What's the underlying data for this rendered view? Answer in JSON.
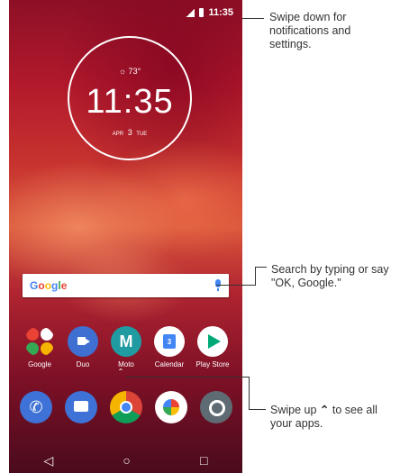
{
  "status_bar": {
    "time": "11:35"
  },
  "clock_widget": {
    "weather": "☼ 73°",
    "time": "11:35",
    "month": "APR",
    "day": "3",
    "weekday": "TUE"
  },
  "search_bar": {
    "logo": [
      "G",
      "o",
      "o",
      "g",
      "l",
      "e"
    ]
  },
  "apps": [
    {
      "label": "Google",
      "icon": "google-folder-icon"
    },
    {
      "label": "Duo",
      "icon": "duo-icon"
    },
    {
      "label": "Moto",
      "icon": "moto-icon"
    },
    {
      "label": "Calendar",
      "icon": "calendar-icon"
    },
    {
      "label": "Play Store",
      "icon": "play-store-icon"
    }
  ],
  "calendar_day": "3",
  "moto_glyph": "M",
  "dock": [
    {
      "icon": "phone-icon"
    },
    {
      "icon": "messages-icon"
    },
    {
      "icon": "chrome-icon"
    },
    {
      "icon": "photos-icon"
    },
    {
      "icon": "camera-icon"
    }
  ],
  "nav_bar": {
    "back": "◁",
    "home": "○",
    "recents": "□"
  },
  "chevron": "ˆ",
  "callouts": {
    "notifications": "Swipe down for notifications and settings.",
    "search": "Search by typing or say \"OK, Google.\"",
    "apps_before": "Swipe up ",
    "apps_after": " to see all your apps."
  },
  "colors": {
    "accent": "#4285F4",
    "wallpaper": "#c8342f"
  }
}
